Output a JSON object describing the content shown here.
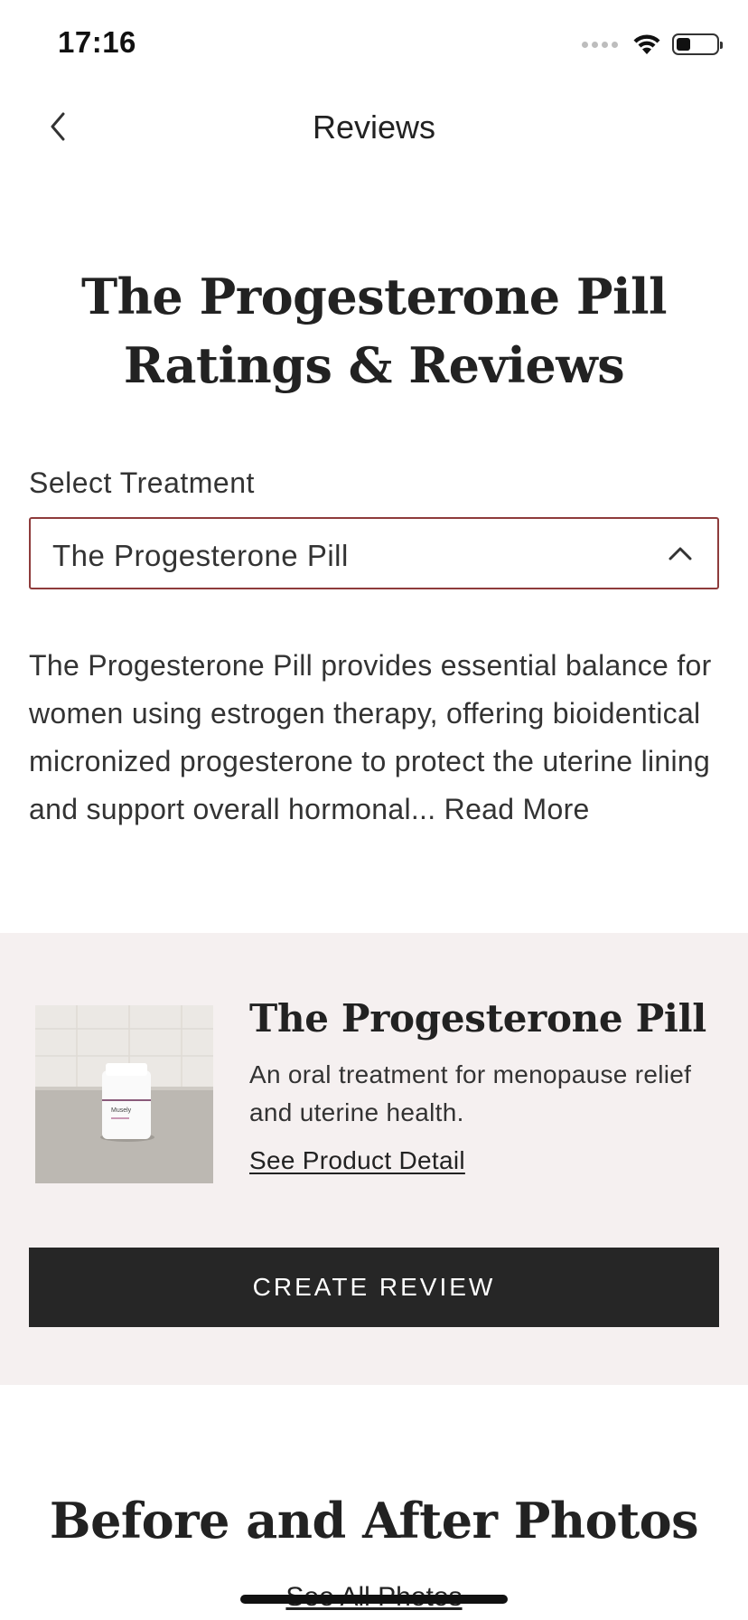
{
  "status_bar": {
    "time": "17:16",
    "icons": [
      "cellular-signal-icon",
      "wifi-icon",
      "battery-icon"
    ],
    "battery_level": 0.35
  },
  "nav": {
    "title": "Reviews",
    "back_icon": "chevron-left-icon"
  },
  "header": {
    "title_line1": "The Progesterone Pill",
    "title_line2": "Ratings & Reviews"
  },
  "treatment_select": {
    "label": "Select Treatment",
    "value": "The Progesterone Pill",
    "chevron_icon": "chevron-up-icon",
    "border_color": "#8e3b3b"
  },
  "description": {
    "text": "The Progesterone Pill provides essential balance for women using estrogen therapy, offering bioidentical micronized progesterone to protect the uterine lining and support overall hormonal...",
    "read_more": "Read More"
  },
  "product_card": {
    "background": "#f5f0f0",
    "name": "The Progesterone Pill",
    "description": "An oral treatment for menopause relief and uterine health.",
    "link": "See Product Detail",
    "bottle_label": "Musely",
    "cta": "CREATE REVIEW",
    "cta_background": "#262626"
  },
  "photos_section": {
    "title": "Before and After Photos",
    "link": "See All Photos"
  }
}
